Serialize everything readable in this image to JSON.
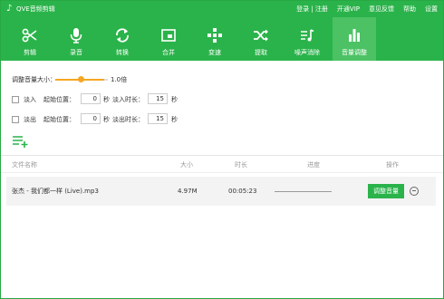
{
  "app": {
    "title": "QVE音频剪辑",
    "logo_icon": "music-note-icon"
  },
  "top_links": [
    "登录 | 注册",
    "开通VIP",
    "意见反馈",
    "帮助",
    "设置"
  ],
  "toolbar": [
    {
      "label": "剪辑",
      "icon": "scissors-icon"
    },
    {
      "label": "录音",
      "icon": "microphone-icon"
    },
    {
      "label": "转换",
      "icon": "convert-icon"
    },
    {
      "label": "合并",
      "icon": "merge-icon"
    },
    {
      "label": "变速",
      "icon": "speed-icon"
    },
    {
      "label": "提取",
      "icon": "extract-icon"
    },
    {
      "label": "噪声消除",
      "icon": "noise-reduction-icon"
    },
    {
      "label": "音量调整",
      "icon": "volume-bars-icon",
      "active": true
    }
  ],
  "volume": {
    "label": "调整音量大小：",
    "value": "1.0倍",
    "level": 0.55
  },
  "fade_in": {
    "checkbox_label": "淡入",
    "start_label": "起始位置：",
    "start_value": "0",
    "unit": "秒",
    "duration_label": "淡入时长：",
    "duration_value": "15"
  },
  "fade_out": {
    "checkbox_label": "淡出",
    "start_label": "起始位置：",
    "start_value": "0",
    "unit": "秒",
    "duration_label": "淡出时长：",
    "duration_value": "15"
  },
  "add_icon": "add-list-icon",
  "table": {
    "headers": [
      "文件名称",
      "大小",
      "时长",
      "进度",
      "操作"
    ],
    "rows": [
      {
        "name": "张杰 - 我们都一样 (Live).mp3",
        "size": "4.97M",
        "duration": "00:05:23",
        "progress": 0,
        "action": "调整音量"
      }
    ]
  },
  "colors": {
    "brand_green": "#2ab34a",
    "active_tab": "#4cc264",
    "slider_orange": "#f5a623"
  }
}
